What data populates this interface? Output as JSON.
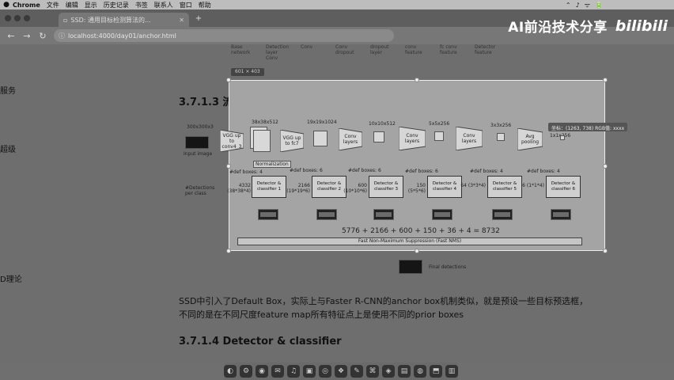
{
  "menubar": {
    "apple": "",
    "items": [
      "Chrome",
      "文件",
      "编辑",
      "显示",
      "历史记录",
      "书签",
      "联系人",
      "窗口",
      "帮助"
    ],
    "right_items": [
      "⌃",
      "♪",
      "ᯤ",
      "🔋"
    ]
  },
  "watermark": {
    "text": "AI前沿技术分享",
    "logo": "bilibili"
  },
  "browser": {
    "tab_title": "SSD: 通用目标检测算法的...",
    "new_tab": "+",
    "back": "←",
    "forward": "→",
    "reload": "↻",
    "url": "localhost:4000/day01/anchor.html"
  },
  "sidebar": {
    "items": [
      "服务",
      "超级",
      "D理论"
    ]
  },
  "toc": {
    "items": [
      "Base network",
      "Detection layer Conv",
      "Conv",
      "Conv dropout",
      "dropout layer",
      "conv feature",
      "fc conv feature",
      "Detector feature"
    ]
  },
  "image": {
    "size_badge": "601 × 403",
    "coord_badge": "坐标：(1263, 738)  RGB值: xxxx",
    "input_label": "Input image",
    "input_top": "300x300x3",
    "dets_label": "#Detections per class",
    "stage_dims": [
      "38x38x512",
      "19x19x1024",
      "10x10x512",
      "5x5x256",
      "3x3x256",
      "1x1x256"
    ],
    "blocks": [
      "VGG up to conv4_3",
      "VGG up to fc7",
      "Conv layers",
      "Conv layers",
      "Conv layers",
      "Avg pooling"
    ],
    "normalization": "Normalization",
    "defboxes": [
      "#def boxes: 4",
      "#def boxes: 6",
      "#def boxes: 6",
      "#def boxes: 6",
      "#def boxes: 4",
      "#def boxes: 4"
    ],
    "detectors": [
      "Detector & classifier 1",
      "Detector & classifier 2",
      "Detector & classifier 3",
      "Detector & classifier 4",
      "Detector & classifier 5",
      "Detector & classifier 6"
    ],
    "counts": [
      "4332 (38*38*4)",
      "2166 (19*19*6)",
      "600 (10*10*6)",
      "150 (5*5*6)",
      "64 (3*3*4)",
      "6 (1*1*4)"
    ],
    "sum": "5776 + 2166 + 600 + 150 + 36 + 4 = 8732",
    "nms": "Fast Non-Maximum Suppression (Fast NMS)",
    "final_label": "Final detections"
  },
  "content": {
    "heading1": "3.7.1.3 流程",
    "para": "SSD中引入了Default Box，实际上与Faster R-CNN的anchor box机制类似，就是预设一些目标预选框，不同的是在不同尺度feature map所有特征点上是使用不同的prior boxes",
    "heading2": "3.7.1.4 Detector & classifier"
  },
  "dock": {
    "icons": [
      "◐",
      "⚙",
      "◉",
      "✉",
      "♫",
      "▣",
      "◎",
      "❖",
      "✎",
      "⌘",
      "◈",
      "▤",
      "◍",
      "⬒",
      "▥"
    ]
  }
}
